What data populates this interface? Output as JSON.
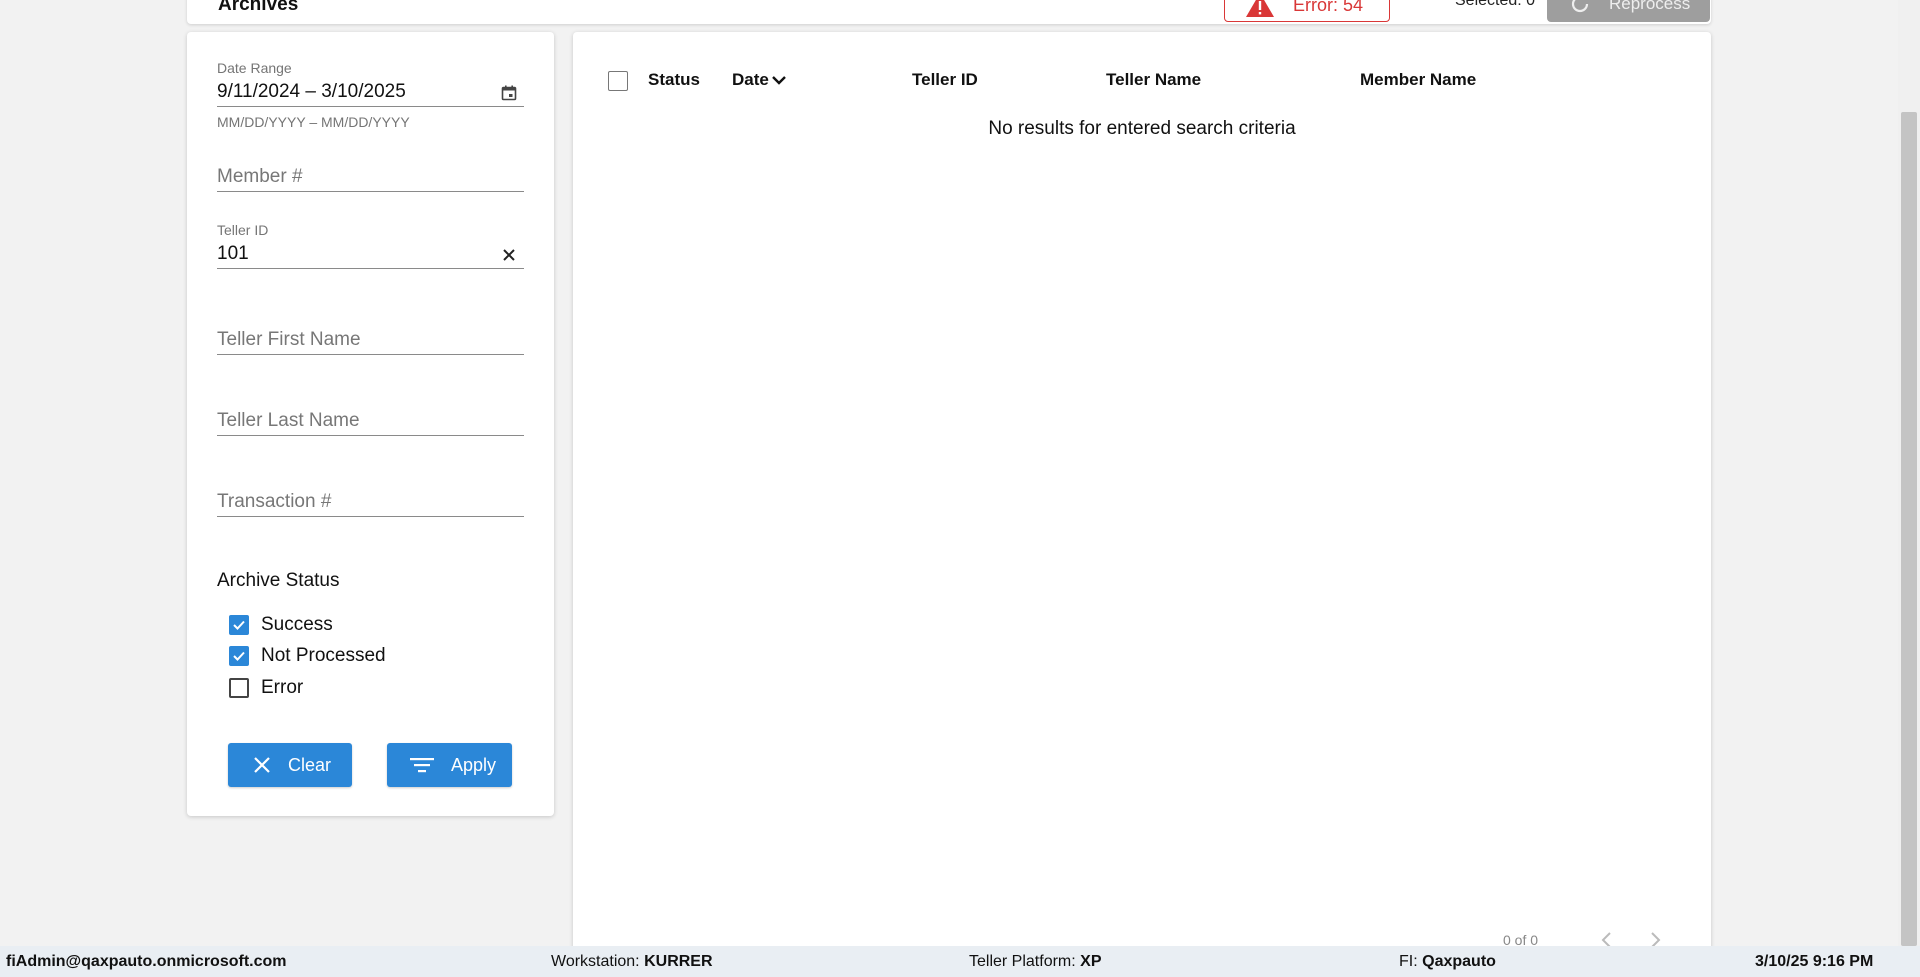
{
  "header": {
    "title": "Archives",
    "error_badge": "Error: 54",
    "selected_label": "Selected: 0",
    "reprocess_label": "Reprocess"
  },
  "filters": {
    "date_range": {
      "label": "Date Range",
      "value": "9/11/2024 – 3/10/2025",
      "hint": "MM/DD/YYYY – MM/DD/YYYY"
    },
    "member_number": {
      "placeholder": "Member #"
    },
    "teller_id": {
      "label": "Teller ID",
      "value": "101"
    },
    "teller_first_name": {
      "placeholder": "Teller First Name"
    },
    "teller_last_name": {
      "placeholder": "Teller Last Name"
    },
    "transaction_number": {
      "placeholder": "Transaction #"
    },
    "archive_status": {
      "heading": "Archive Status",
      "options": [
        {
          "label": "Success",
          "checked": true
        },
        {
          "label": "Not Processed",
          "checked": true
        },
        {
          "label": "Error",
          "checked": false
        }
      ]
    },
    "clear_label": "Clear",
    "apply_label": "Apply"
  },
  "table": {
    "columns": [
      "Status",
      "Date",
      "Teller ID",
      "Teller Name",
      "Member Name"
    ],
    "empty_message": "No results for entered search criteria",
    "pagination": "0 of 0"
  },
  "status_bar": {
    "user": "fiAdmin@qaxpauto.onmicrosoft.com",
    "workstation_label": "Workstation:",
    "workstation_value": "KURRER",
    "platform_label": "Teller Platform:",
    "platform_value": "XP",
    "fi_label": "FI:",
    "fi_value": "Qaxpauto",
    "datetime": "3/10/25 9:16 PM"
  },
  "colors": {
    "primary": "#2b87d8",
    "error": "#d93737",
    "disabled": "#9e9e9e"
  }
}
